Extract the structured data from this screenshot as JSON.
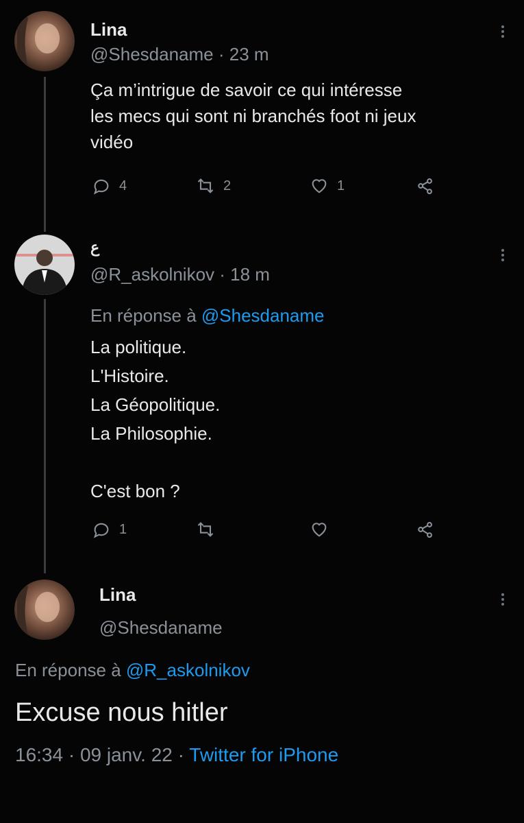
{
  "tweets": [
    {
      "name": "Lina",
      "handle": "@Shesdaname",
      "separator": " · ",
      "time": "23 m",
      "text": "Ça m’intrigue de savoir ce qui intéresse\nles mecs qui sont ni branchés foot ni jeux\nvidéo",
      "replies": "4",
      "retweets": "2",
      "likes": "1"
    },
    {
      "name": "ع",
      "handle": "@R_askolnikov",
      "separator": " · ",
      "time": "18 m",
      "reply_prefix": "En réponse à ",
      "reply_to": "@Shesdaname",
      "text": "La politique.\nL'Histoire.\nLa Géopolitique.\nLa Philosophie.\n\nC'est bon ?",
      "replies": "1",
      "retweets": "",
      "likes": ""
    }
  ],
  "main_tweet": {
    "name": "Lina",
    "handle": "@Shesdaname",
    "reply_prefix": "En réponse à ",
    "reply_to": "@R_askolnikov",
    "text": "Excuse nous hitler",
    "time": "16:34",
    "sep1": " · ",
    "date": "09 janv. 22",
    "sep2": " · ",
    "source": "Twitter for iPhone"
  },
  "icons": [
    "reply-icon",
    "retweet-icon",
    "like-icon",
    "share-icon",
    "more-options-icon"
  ],
  "colors": {
    "background": "#050505",
    "text": "#e7e9ea",
    "secondary": "#8b9198",
    "link": "#1d9bf0"
  }
}
